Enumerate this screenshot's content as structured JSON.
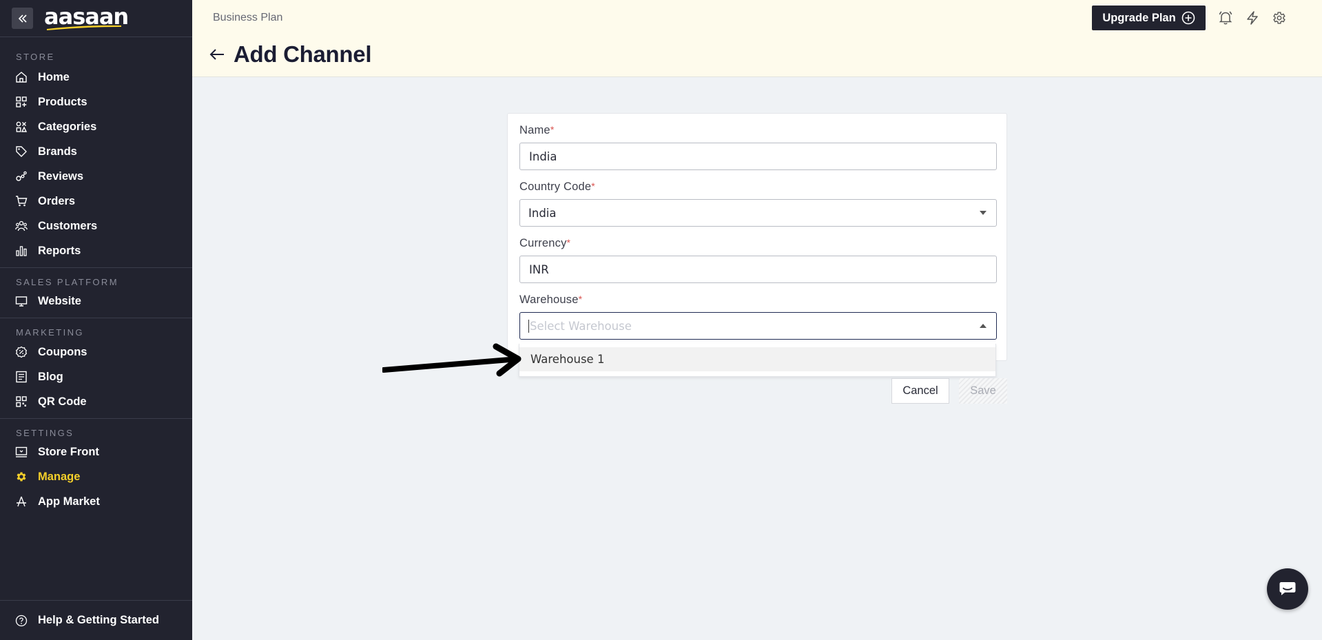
{
  "brand": {
    "logo_text": "aasaan",
    "accent": "#f4cf2a"
  },
  "sidebar": {
    "sections": [
      {
        "title": "STORE",
        "items": [
          {
            "label": "Home",
            "icon": "home-icon"
          },
          {
            "label": "Products",
            "icon": "products-icon"
          },
          {
            "label": "Categories",
            "icon": "categories-icon"
          },
          {
            "label": "Brands",
            "icon": "tag-icon"
          },
          {
            "label": "Reviews",
            "icon": "reviews-icon"
          },
          {
            "label": "Orders",
            "icon": "cart-icon"
          },
          {
            "label": "Customers",
            "icon": "customers-icon"
          },
          {
            "label": "Reports",
            "icon": "bar-chart-icon"
          }
        ]
      },
      {
        "title": "SALES PLATFORM",
        "items": [
          {
            "label": "Website",
            "icon": "monitor-icon"
          }
        ]
      },
      {
        "title": "MARKETING",
        "items": [
          {
            "label": "Coupons",
            "icon": "coupon-icon"
          },
          {
            "label": "Blog",
            "icon": "blog-icon"
          },
          {
            "label": "QR Code",
            "icon": "qr-code-icon"
          }
        ]
      },
      {
        "title": "SETTINGS",
        "items": [
          {
            "label": "Store Front",
            "icon": "store-front-icon"
          },
          {
            "label": "Manage",
            "icon": "gear-icon",
            "active": true
          },
          {
            "label": "App Market",
            "icon": "app-market-icon"
          }
        ]
      }
    ],
    "help_label": "Help & Getting Started"
  },
  "header": {
    "plan_label": "Business Plan",
    "page_title": "Add Channel",
    "upgrade_label": "Upgrade Plan"
  },
  "form": {
    "name": {
      "label": "Name",
      "value": "India"
    },
    "country_code": {
      "label": "Country Code",
      "value": "India"
    },
    "currency": {
      "label": "Currency",
      "value": "INR"
    },
    "warehouse": {
      "label": "Warehouse",
      "placeholder": "Select Warehouse",
      "options": [
        "Warehouse 1"
      ]
    },
    "required_mark": "*",
    "cancel_label": "Cancel",
    "save_label": "Save"
  }
}
